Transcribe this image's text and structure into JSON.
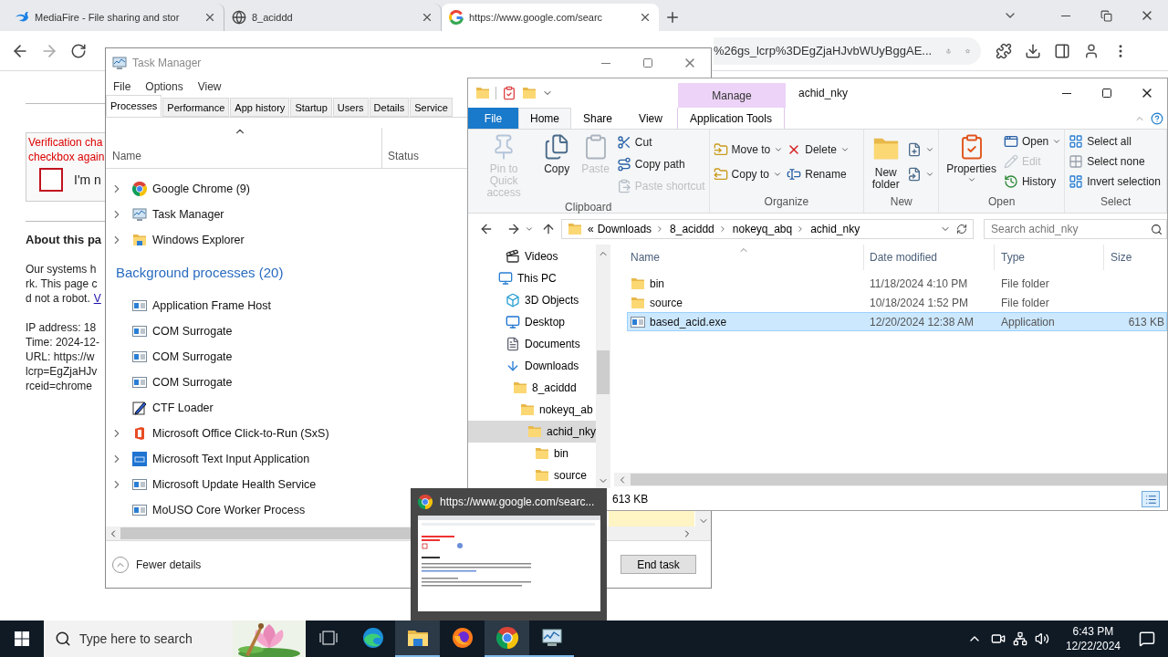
{
  "browser": {
    "tabs": [
      {
        "title": "MediaFire - File sharing and stor",
        "kind": "mediafire",
        "selected": false
      },
      {
        "title": "8_aciddd",
        "kind": "globe",
        "selected": false
      },
      {
        "title": "https://www.google.com/searc",
        "kind": "google",
        "selected": true
      }
    ],
    "address": "%26gs_lcrp%3DEgZjaHJvbWUyBggAE...",
    "page": {
      "error_lines": [
        "Verification cha",
        "checkbox again"
      ],
      "checkbox_checked": false,
      "checkbox_label": "I'm n",
      "heading": "About this pa",
      "paragraph_lines": [
        "Our systems h",
        "rk. This page c",
        "d not a robot."
      ],
      "link": "V",
      "info_lines": [
        "IP address: 18",
        "Time: 2024-12-",
        "URL: https://w",
        "lcrp=EgZjaHJv",
        "rceid=chrome"
      ]
    }
  },
  "task_manager": {
    "title": "Task Manager",
    "menu": [
      "File",
      "Options",
      "View"
    ],
    "tabs": [
      {
        "label": "Processes",
        "selected": true
      },
      {
        "label": "Performance",
        "selected": false
      },
      {
        "label": "App history",
        "selected": false
      },
      {
        "label": "Startup",
        "selected": false
      },
      {
        "label": "Users",
        "selected": false
      },
      {
        "label": "Details",
        "selected": false
      },
      {
        "label": "Service",
        "selected": false
      }
    ],
    "columns": [
      "Name",
      "Status"
    ],
    "apps": [
      {
        "name": "Google Chrome (9)",
        "kind": "chrome",
        "expandable": true
      },
      {
        "name": "Task Manager",
        "kind": "taskmgr",
        "expandable": true
      },
      {
        "name": "Windows Explorer",
        "kind": "explorer",
        "expandable": true
      }
    ],
    "group_title": "Background processes (20)",
    "background": [
      {
        "name": "Application Frame Host",
        "kind": "app",
        "expandable": false
      },
      {
        "name": "COM Surrogate",
        "kind": "app",
        "expandable": false
      },
      {
        "name": "COM Surrogate",
        "kind": "app",
        "expandable": false
      },
      {
        "name": "COM Surrogate",
        "kind": "app",
        "expandable": false
      },
      {
        "name": "CTF Loader",
        "kind": "ctf",
        "expandable": false
      },
      {
        "name": "Microsoft Office Click-to-Run (SxS)",
        "kind": "office",
        "expandable": true
      },
      {
        "name": "Microsoft Text Input Application",
        "kind": "text-input",
        "expandable": true
      },
      {
        "name": "Microsoft Update Health Service",
        "kind": "app",
        "expandable": true
      },
      {
        "name": "MoUSO Core Worker Process",
        "kind": "app",
        "expandable": false
      }
    ],
    "footer": "Fewer details",
    "end_task": "End task"
  },
  "explorer": {
    "title": "achid_nky",
    "context_tab": "Manage",
    "ribbon_tabs": [
      {
        "label": "File",
        "kind": "file",
        "selected": false
      },
      {
        "label": "Home",
        "kind": "tab",
        "selected": true
      },
      {
        "label": "Share",
        "kind": "tab",
        "selected": false
      },
      {
        "label": "View",
        "kind": "tab",
        "selected": false
      },
      {
        "label": "Application Tools",
        "kind": "context",
        "selected": false
      }
    ],
    "ribbon_groups": [
      {
        "label": "Clipboard",
        "columns": [
          {
            "kind": "large",
            "items": [
              {
                "label": "Pin to Quick access",
                "kind": "pin",
                "disabled": true,
                "dropdown": false
              }
            ]
          },
          {
            "kind": "large",
            "items": [
              {
                "label": "Copy",
                "kind": "copy",
                "disabled": false,
                "dropdown": false
              }
            ]
          },
          {
            "kind": "large",
            "items": [
              {
                "label": "Paste",
                "kind": "paste",
                "disabled": true,
                "dropdown": false
              }
            ]
          },
          {
            "kind": "small",
            "items": [
              {
                "label": "Cut",
                "kind": "cut",
                "disabled": false,
                "dropdown": false
              },
              {
                "label": "Copy path",
                "kind": "copy-path",
                "disabled": false,
                "dropdown": false
              },
              {
                "label": "Paste shortcut",
                "kind": "paste-shortcut",
                "disabled": true,
                "dropdown": false
              }
            ]
          }
        ]
      },
      {
        "label": "Organize",
        "columns": [
          {
            "kind": "small",
            "items": [
              {
                "label": "Move to",
                "kind": "move",
                "disabled": false,
                "dropdown": true
              },
              {
                "label": "Copy to",
                "kind": "copy-to",
                "disabled": false,
                "dropdown": true
              }
            ]
          },
          {
            "kind": "small",
            "items": [
              {
                "label": "Delete",
                "kind": "delete",
                "disabled": false,
                "dropdown": true
              },
              {
                "label": "Rename",
                "kind": "rename",
                "disabled": false,
                "dropdown": false
              }
            ]
          }
        ]
      },
      {
        "label": "New",
        "columns": [
          {
            "kind": "large",
            "items": [
              {
                "label": "New folder",
                "kind": "new-folder",
                "disabled": false,
                "dropdown": false
              }
            ]
          },
          {
            "kind": "small",
            "items": [
              {
                "kind": "new-item",
                "disabled": false,
                "dropdown": true
              },
              {
                "kind": "easy-access",
                "disabled": false,
                "dropdown": true
              }
            ]
          }
        ]
      },
      {
        "label": "Open",
        "columns": [
          {
            "kind": "large",
            "items": [
              {
                "label": "Properties",
                "kind": "properties",
                "disabled": false,
                "dropdown": true
              }
            ]
          },
          {
            "kind": "small",
            "items": [
              {
                "label": "Open",
                "kind": "open",
                "disabled": false,
                "dropdown": true
              },
              {
                "label": "Edit",
                "kind": "edit",
                "disabled": true,
                "dropdown": false
              },
              {
                "label": "History",
                "kind": "history",
                "disabled": false,
                "dropdown": false
              }
            ]
          }
        ]
      },
      {
        "label": "Select",
        "columns": [
          {
            "kind": "small",
            "items": [
              {
                "label": "Select all",
                "kind": "select-all",
                "disabled": false,
                "dropdown": false
              },
              {
                "label": "Select none",
                "kind": "select-none",
                "disabled": false,
                "dropdown": false
              },
              {
                "label": "Invert selection",
                "kind": "invert",
                "disabled": false,
                "dropdown": false
              }
            ]
          }
        ]
      }
    ],
    "path_overflow": "«",
    "breadcrumbs": [
      "Downloads",
      "8_aciddd",
      "nokeyq_abq",
      "achid_nky"
    ],
    "search_placeholder": "Search achid_nky",
    "nav_scrolled": [
      {
        "label": "Videos",
        "kind": "videos",
        "selected": false
      }
    ],
    "nav_tree": [
      {
        "label": "This PC",
        "kind": "pc",
        "selected": false,
        "children": [
          {
            "label": "3D Objects",
            "kind": "cube",
            "selected": false
          },
          {
            "label": "Desktop",
            "kind": "desktop",
            "selected": false
          },
          {
            "label": "Documents",
            "kind": "documents",
            "selected": false
          },
          {
            "label": "Downloads",
            "kind": "downloads",
            "selected": false,
            "children": [
              {
                "label": "8_aciddd",
                "kind": "folder",
                "selected": false,
                "children": [
                  {
                    "label": "nokeyq_ab",
                    "kind": "folder",
                    "selected": false,
                    "children": [
                      {
                        "label": "achid_nky",
                        "kind": "folder",
                        "selected": true,
                        "children": [
                          {
                            "label": "bin",
                            "kind": "folder",
                            "selected": false
                          },
                          {
                            "label": "source",
                            "kind": "folder",
                            "selected": false
                          }
                        ]
                      }
                    ]
                  }
                ]
              }
            ]
          }
        ]
      }
    ],
    "columns": [
      "Name",
      "Date modified",
      "Type",
      "Size"
    ],
    "files": [
      {
        "name": "bin",
        "kind": "folder",
        "date": "11/18/2024 4:10 PM",
        "type": "File folder",
        "selected": false
      },
      {
        "name": "source",
        "kind": "folder",
        "date": "10/18/2024 1:52 PM",
        "type": "File folder",
        "selected": false
      },
      {
        "name": "based_acid.exe",
        "kind": "app",
        "date": "12/20/2024 12:38 AM",
        "type": "Application",
        "size": "613 KB",
        "selected": true
      }
    ],
    "status": "613 KB"
  },
  "thumbnail": {
    "title": "https://www.google.com/searc..."
  },
  "taskbar": {
    "search_placeholder": "Type here to search",
    "apps": [
      {
        "kind": "task-view",
        "running": false,
        "active": false
      },
      {
        "kind": "edge",
        "running": false,
        "active": false
      },
      {
        "kind": "explorer",
        "running": true,
        "active": true
      },
      {
        "kind": "firefox",
        "running": false,
        "active": false
      },
      {
        "kind": "chrome",
        "running": true,
        "active": true
      },
      {
        "kind": "taskmgr",
        "running": true,
        "active": false
      }
    ],
    "time": "6:43 PM",
    "date": "12/22/2024"
  }
}
